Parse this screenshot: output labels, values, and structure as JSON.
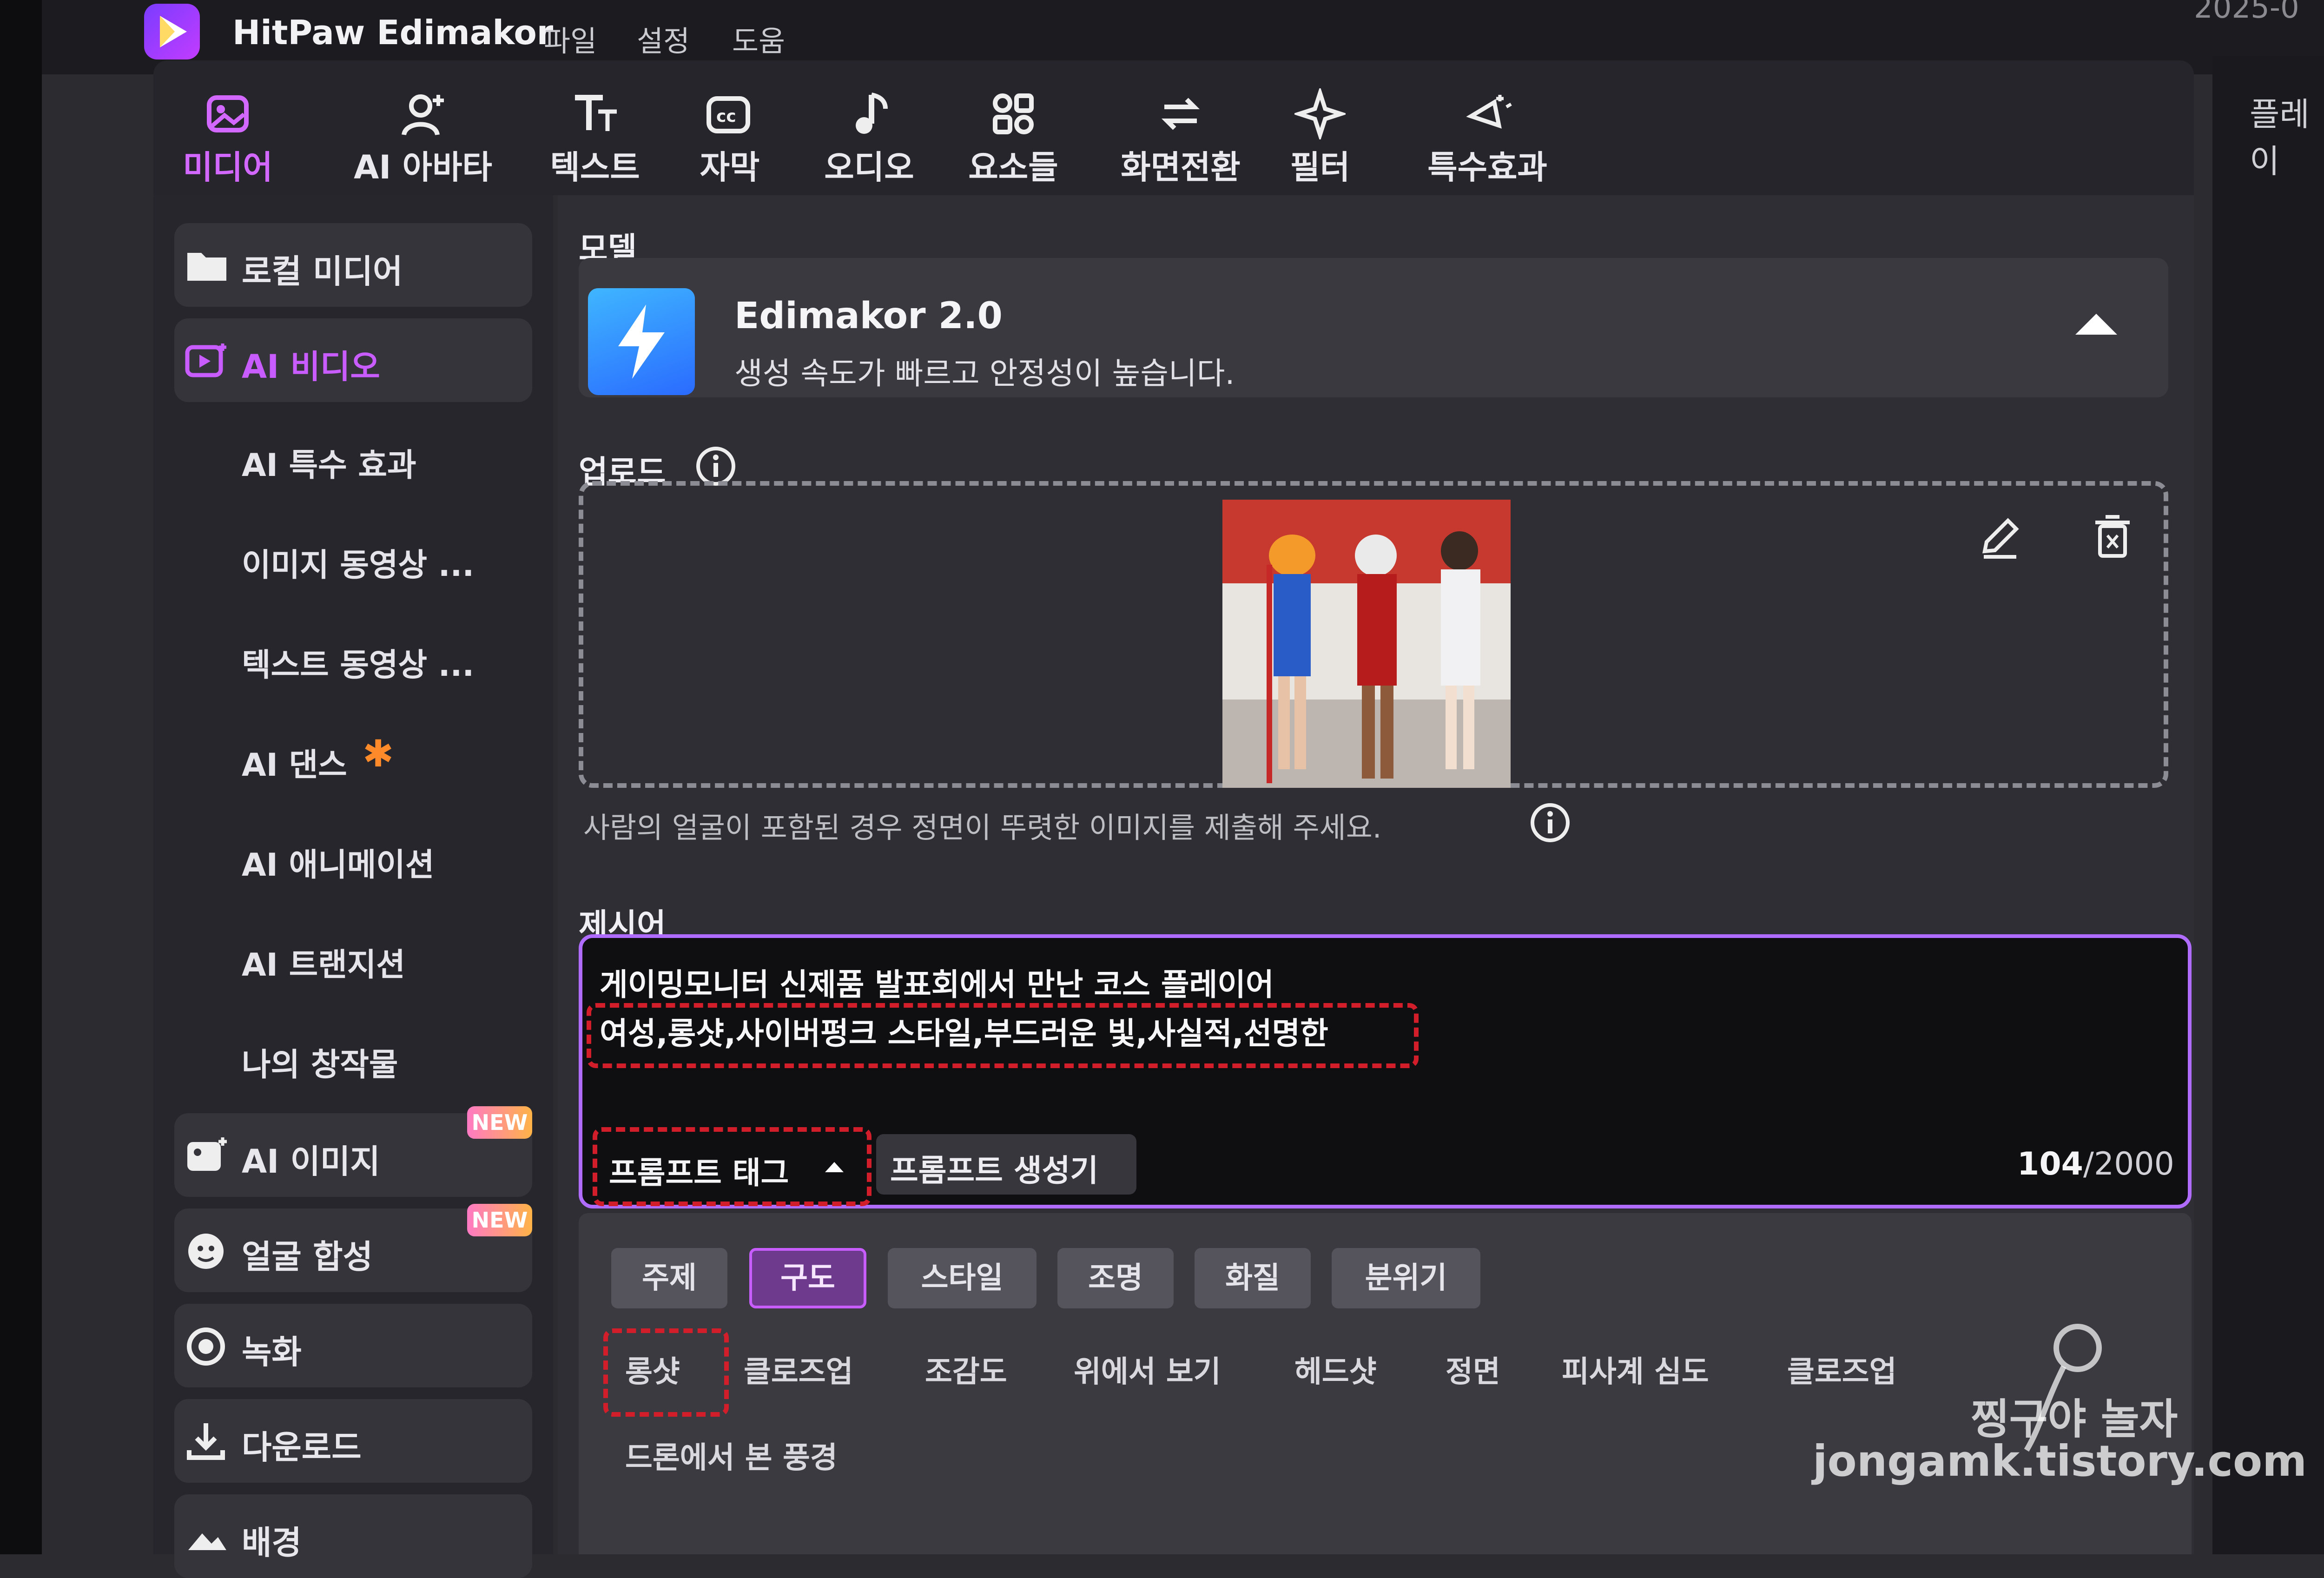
{
  "titlebar": {
    "app_name": "HitPaw Edimakor",
    "menus": [
      "파일",
      "설정",
      "도움"
    ],
    "clock": "2025-0"
  },
  "toolbar": {
    "tools": [
      {
        "label": "미디어",
        "icon": "media-icon",
        "active": true
      },
      {
        "label": "AI 아바타",
        "icon": "avatar-icon",
        "active": false
      },
      {
        "label": "텍스트",
        "icon": "text-icon",
        "active": false
      },
      {
        "label": "자막",
        "icon": "caption-icon",
        "active": false
      },
      {
        "label": "오디오",
        "icon": "music-note-icon",
        "active": false
      },
      {
        "label": "요소들",
        "icon": "elements-icon",
        "active": false
      },
      {
        "label": "화면전환",
        "icon": "transition-icon",
        "active": false
      },
      {
        "label": "필터",
        "icon": "sparkle-icon",
        "active": false
      },
      {
        "label": "특수효과",
        "icon": "effects-icon",
        "active": false
      }
    ],
    "right_tab": "플레이"
  },
  "sidebar": {
    "local_media": "로컬 미디어",
    "ai_video": "AI 비디오",
    "sub_items": [
      "AI 특수 효과",
      "이미지 동영상 ...",
      "텍스트 동영상 ...",
      "AI 댄스",
      "AI 애니메이션",
      "AI 트랜지션",
      "나의 창작물"
    ],
    "ai_image": "AI 이미지",
    "face_swap": "얼굴 합성",
    "record": "녹화",
    "download": "다운로드",
    "background": "배경",
    "new_badge": "NEW"
  },
  "main": {
    "model_title": "모델",
    "model_name": "Edimakor 2.0",
    "model_desc": "생성 속도가 빠르고 안정성이 높습니다.",
    "upload_title": "업로드",
    "upload_hint": "사람의 얼굴이 포함된 경우 정면이 뚜렷한 이미지를 제출해 주세요.",
    "prompt_title": "제시어",
    "prompt_line1": "게이밍모니터 신제품 발표회에서 만난 코스 플레이어",
    "prompt_line2": "여성,롱샷,사이버펑크 스타일,부드러운 빛,사실적,선명한",
    "prompt_tag_btn": "프롬프트 태그",
    "prompt_gen_btn": "프롬프트 생성기",
    "char_count": "104",
    "char_max": "/2000"
  },
  "tags": {
    "categories": [
      "주제",
      "구도",
      "스타일",
      "조명",
      "화질",
      "분위기"
    ],
    "active_category": "구도",
    "row1": [
      "롱샷",
      "클로즈업",
      "조감도",
      "위에서 보기",
      "헤드샷",
      "정면",
      "피사계 심도",
      "클로즈업"
    ],
    "row2": [
      "드론에서 본 풍경"
    ]
  },
  "watermark": {
    "line1": "찡구야 놀자",
    "line2": "jongamk.tistory.com"
  },
  "colors": {
    "accent": "#c85cff",
    "highlight_red": "#d21e2a",
    "panel": "#2f2e34"
  }
}
